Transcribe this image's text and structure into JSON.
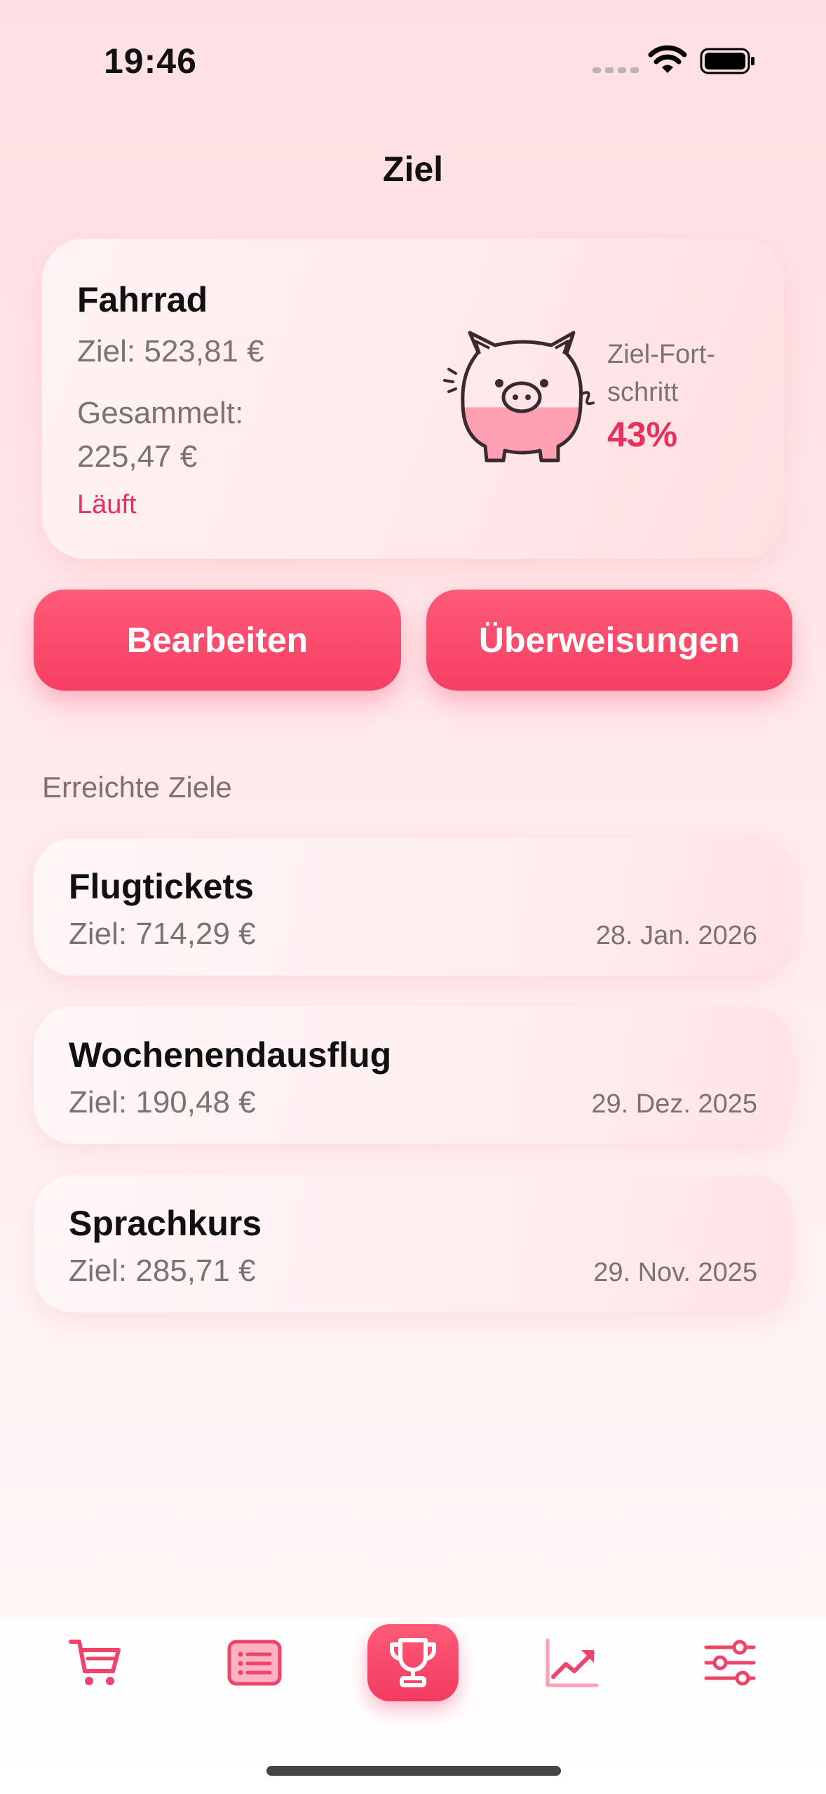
{
  "status_bar": {
    "time": "19:46"
  },
  "nav": {
    "title": "Ziel"
  },
  "current_goal": {
    "name": "Fahrrad",
    "target": "Ziel: 523,81 €",
    "saved": "Gesammelt: 225,47 €",
    "status": "Läuft",
    "progress_label": "Ziel-Fort-schritt",
    "progress_value": "43%",
    "progress_fraction": 0.43
  },
  "actions": {
    "edit_label": "Bearbeiten",
    "transfers_label": "Überweisungen"
  },
  "achieved": {
    "title": "Erreichte Ziele",
    "items": [
      {
        "name": "Flugtickets",
        "target": "Ziel: 714,29 €",
        "date": "28. Jan. 2026"
      },
      {
        "name": "Wochenendausflug",
        "target": "Ziel: 190,48 €",
        "date": "29. Dez. 2025"
      },
      {
        "name": "Sprachkurs",
        "target": "Ziel: 285,71 €",
        "date": "29. Nov. 2025"
      }
    ]
  },
  "tabbar": {
    "items": [
      {
        "icon": "cart-icon"
      },
      {
        "icon": "list-icon"
      },
      {
        "icon": "trophy-icon",
        "active": true
      },
      {
        "icon": "chart-icon"
      },
      {
        "icon": "sliders-icon"
      }
    ]
  },
  "colors": {
    "accent": "#f73f62",
    "text_secondary": "#7a7273",
    "background": "#ffe4e7"
  }
}
